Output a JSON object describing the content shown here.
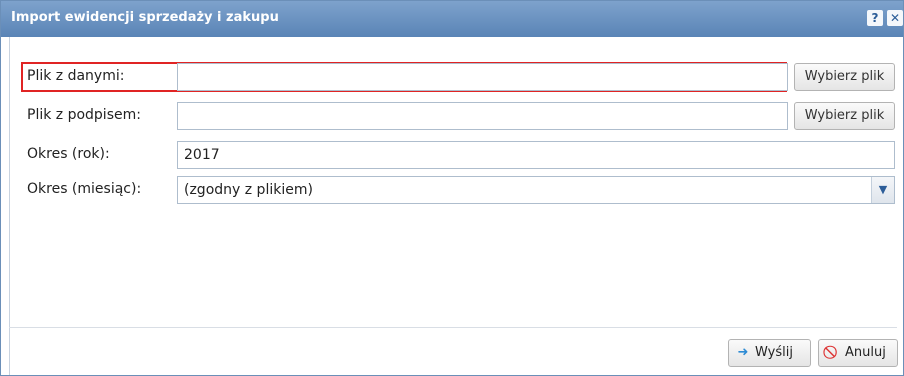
{
  "dialog": {
    "title": "Import ewidencji sprzedaży i zakupu",
    "help_icon": "question-icon",
    "close_icon": "close-icon"
  },
  "form": {
    "data_file": {
      "label": "Plik z danymi:",
      "value": "",
      "button": "Wybierz plik"
    },
    "signature_file": {
      "label": "Plik z podpisem:",
      "value": "",
      "button": "Wybierz plik"
    },
    "period_year": {
      "label": "Okres (rok):",
      "value": "2017"
    },
    "period_month": {
      "label": "Okres (miesiąc):",
      "value": "(zgodny z plikiem)"
    }
  },
  "footer": {
    "send_label": "Wyślij",
    "send_icon": "arrow-right-icon",
    "cancel_label": "Anuluj",
    "cancel_icon": "cancel-icon"
  },
  "colors": {
    "titlebar": "#5a84b6",
    "highlight": "#e02424"
  }
}
